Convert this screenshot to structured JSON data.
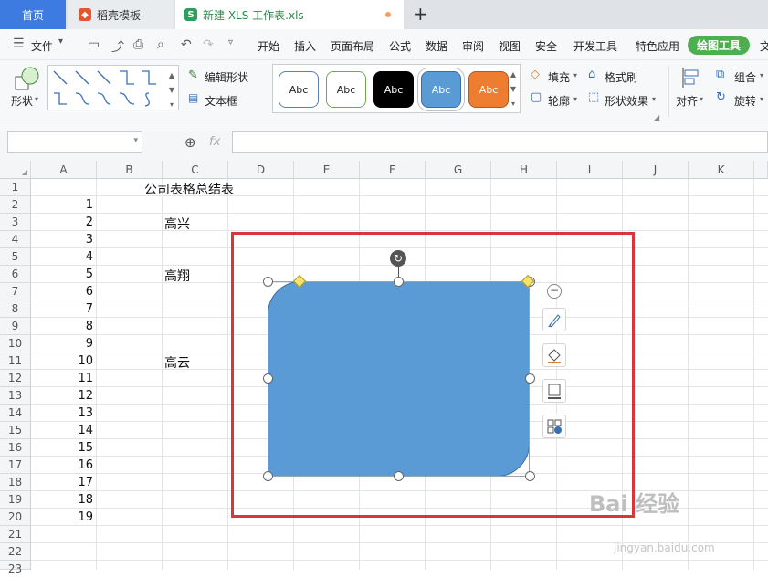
{
  "tabs": {
    "home": "首页",
    "template": "稻壳模板",
    "file": "新建 XLS 工作表.xls",
    "add": "+"
  },
  "menu": {
    "file": "文件",
    "items": [
      "开始",
      "插入",
      "页面布局",
      "公式",
      "数据",
      "审阅",
      "视图",
      "安全",
      "开发工具",
      "特色应用"
    ],
    "active_tab": "绘图工具",
    "cut_off": "文"
  },
  "ribbon": {
    "shape": "形状",
    "edit_shape": "编辑形状",
    "text_box": "文本框",
    "style_sample": "Abc",
    "fill": "填充",
    "outline": "轮廓",
    "format_painter": "格式刷",
    "shape_effects": "形状效果",
    "align": "对齐",
    "group": "组合",
    "rotate": "旋转"
  },
  "formula_bar": {
    "fx": "fx",
    "namebox_value": "",
    "formula_value": ""
  },
  "sheet": {
    "columns": [
      "A",
      "B",
      "C",
      "D",
      "E",
      "F",
      "G",
      "H",
      "I",
      "J",
      "K"
    ],
    "rows": [
      "1",
      "2",
      "3",
      "4",
      "5",
      "6",
      "7",
      "8",
      "9",
      "10",
      "11",
      "12",
      "13",
      "14",
      "15",
      "16",
      "17",
      "18",
      "19",
      "20",
      "21",
      "22",
      "23"
    ],
    "title": "公司表格总结表",
    "a_values": [
      "1",
      "2",
      "3",
      "4",
      "5",
      "6",
      "7",
      "8",
      "9",
      "10",
      "11",
      "12",
      "13",
      "14",
      "15",
      "16",
      "17",
      "18",
      "19"
    ],
    "names": [
      "高兴",
      "高翔",
      "高云"
    ]
  },
  "colors": {
    "accent": "#3d7be0",
    "draw_tools_tab": "#4caf50",
    "shape_fill": "#5b9bd5",
    "highlight_frame": "#d9363a",
    "style_black": "#000000",
    "style_blue": "#5b9bd5",
    "style_orange": "#ed7d31"
  },
  "watermark": {
    "brand": "Bai 经验",
    "url": "jingyan.baidu.com"
  }
}
